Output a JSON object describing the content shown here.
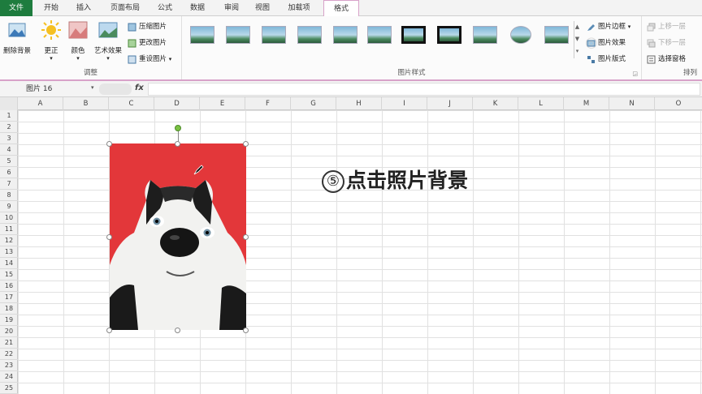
{
  "tabs": [
    "文件",
    "开始",
    "插入",
    "页面布局",
    "公式",
    "数据",
    "审阅",
    "视图",
    "加载项",
    "格式"
  ],
  "ribbon": {
    "adjust": {
      "remove_bg": "删除背景",
      "correct": "更正",
      "color": "颜色",
      "art_effects": "艺术效果",
      "compress": "压缩图片",
      "change": "更改图片",
      "reset": "重设图片",
      "label": "调整"
    },
    "styles": {
      "label": "图片样式",
      "border": "图片边框",
      "effects": "图片效果",
      "layout": "图片版式"
    },
    "arrange": {
      "label": "排列",
      "bring_forward": "上移一层",
      "send_backward": "下移一层",
      "selection_pane": "选择窗格"
    }
  },
  "formula_bar": {
    "name_box": "图片 16",
    "fx": "fx"
  },
  "columns": [
    "A",
    "B",
    "C",
    "D",
    "E",
    "F",
    "G",
    "H",
    "I",
    "J",
    "K",
    "L",
    "M",
    "N",
    "O"
  ],
  "rows": [
    "1",
    "2",
    "3",
    "4",
    "5",
    "6",
    "7",
    "8",
    "9",
    "10",
    "11",
    "12",
    "13",
    "14",
    "15",
    "16",
    "17",
    "18",
    "19",
    "20",
    "21",
    "22",
    "23",
    "24",
    "25"
  ],
  "instruction": {
    "step": "⑤",
    "text": "点击照片背景"
  },
  "colors": {
    "file_tab": "#1e7c3e",
    "accent": "#d8a2c9",
    "photo_bg": "#e3373a"
  }
}
